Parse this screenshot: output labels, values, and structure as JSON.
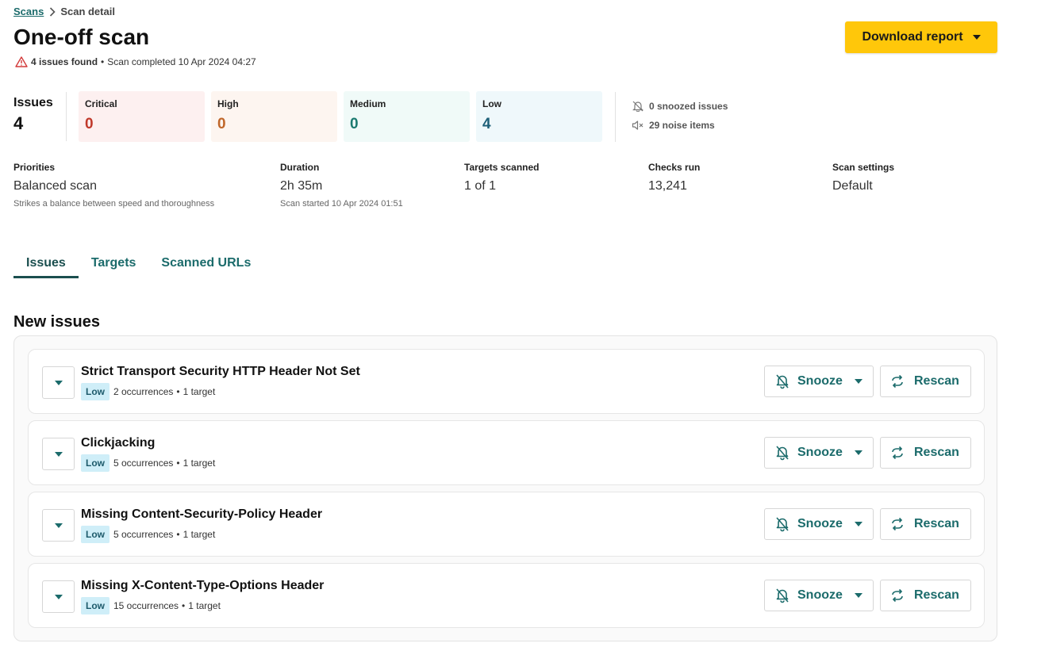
{
  "breadcrumb": {
    "root": "Scans",
    "current": "Scan detail"
  },
  "title": "One-off scan",
  "summary": {
    "issues_found": "4 issues found",
    "separator": "•",
    "completed": "Scan completed 10 Apr 2024 04:27"
  },
  "download": {
    "label": "Download report"
  },
  "issues": {
    "label": "Issues",
    "total": "4"
  },
  "severity_counts": [
    {
      "label": "Critical",
      "value": "0",
      "bg": "#fdf0f0",
      "color": "#c0392b"
    },
    {
      "label": "High",
      "value": "0",
      "bg": "#fdf5f0",
      "color": "#c0672b"
    },
    {
      "label": "Medium",
      "value": "0",
      "bg": "#f0faf8",
      "color": "#1b7a70"
    },
    {
      "label": "Low",
      "value": "4",
      "bg": "#eff8fb",
      "color": "#1d5f78"
    }
  ],
  "side": {
    "snoozed": "0 snoozed issues",
    "noise": "29 noise items"
  },
  "meta": {
    "priorities": {
      "label": "Priorities",
      "value": "Balanced scan",
      "sub": "Strikes a balance between speed and thoroughness"
    },
    "duration": {
      "label": "Duration",
      "value": "2h 35m",
      "sub": "Scan started 10 Apr 2024 01:51"
    },
    "targets": {
      "label": "Targets scanned",
      "value": "1 of 1"
    },
    "checks": {
      "label": "Checks run",
      "value": "13,241"
    },
    "settings": {
      "label": "Scan settings",
      "value": "Default"
    }
  },
  "tabs": [
    "Issues",
    "Targets",
    "Scanned URLs"
  ],
  "section_title": "New issues",
  "issue_rows": [
    {
      "title": "Strict Transport Security HTTP Header Not Set",
      "severity": "Low",
      "occurrences": "2 occurrences",
      "sep": "•",
      "targets": "1 target"
    },
    {
      "title": "Clickjacking",
      "severity": "Low",
      "occurrences": "5 occurrences",
      "sep": "•",
      "targets": "1 target"
    },
    {
      "title": "Missing Content-Security-Policy Header",
      "severity": "Low",
      "occurrences": "5 occurrences",
      "sep": "•",
      "targets": "1 target"
    },
    {
      "title": "Missing X-Content-Type-Options Header",
      "severity": "Low",
      "occurrences": "15 occurrences",
      "sep": "•",
      "targets": "1 target"
    }
  ],
  "actions": {
    "snooze": "Snooze",
    "rescan": "Rescan"
  },
  "colors": {
    "accent": "#1b6b6b",
    "primary_button": "#ffc70a",
    "low_badge": "#cfeef8",
    "warning": "#d33a3a"
  }
}
